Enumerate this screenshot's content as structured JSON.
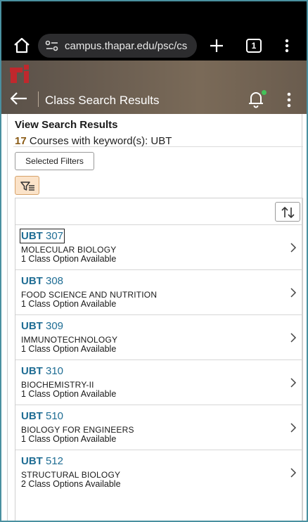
{
  "browser": {
    "url": "campus.thapar.edu/psc/cs",
    "tab_count": "1"
  },
  "header": {
    "title": "Class Search Results",
    "logo_text": "ti"
  },
  "page": {
    "title": "View Search Results",
    "count": "17",
    "count_text": " Courses with keyword(s): UBT",
    "selected_filters_label": "Selected Filters"
  },
  "courses": [
    {
      "subject": "UBT",
      "number": "307",
      "title": "MOLECULAR BIOLOGY",
      "availability": "1 Class Option Available"
    },
    {
      "subject": "UBT",
      "number": "308",
      "title": "FOOD SCIENCE AND NUTRITION",
      "availability": "1 Class Option Available"
    },
    {
      "subject": "UBT",
      "number": "309",
      "title": "IMMUNOTECHNOLOGY",
      "availability": "1 Class Option Available"
    },
    {
      "subject": "UBT",
      "number": "310",
      "title": "BIOCHEMISTRY-II",
      "availability": "1 Class Option Available"
    },
    {
      "subject": "UBT",
      "number": "510",
      "title": "BIOLOGY FOR ENGINEERS",
      "availability": "1 Class Option Available"
    },
    {
      "subject": "UBT",
      "number": "512",
      "title": "STRUCTURAL BIOLOGY",
      "availability": "2 Class Options Available"
    }
  ],
  "icons": {
    "home": "home-icon",
    "site_settings": "tune-icon",
    "new_tab": "plus-icon",
    "browser_menu": "vertical-dots-icon",
    "back": "arrow-left-icon",
    "notifications": "bell-icon",
    "app_menu": "vertical-dots-icon",
    "filter": "filter-icon",
    "sort": "sort-arrows-icon",
    "row": "chevron-right-icon"
  },
  "colors": {
    "course_link": "#1f6d94",
    "count_accent": "#8a5a14",
    "filter_button_bg": "#fbe3c9",
    "notification_dot": "#44c25a"
  }
}
